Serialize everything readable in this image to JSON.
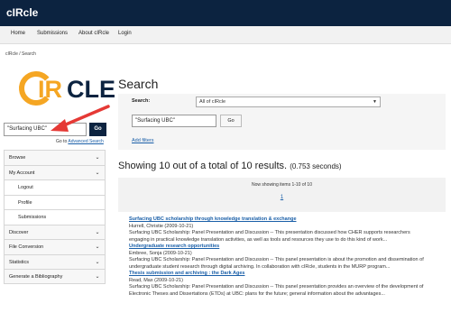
{
  "app": {
    "brand": "cIRcle"
  },
  "nav": {
    "items": [
      "Home",
      "Submissions",
      "About cIRcle",
      "Login"
    ]
  },
  "breadcrumb": "cIRcle  /  Search",
  "logo": {
    "text_prefix": "C",
    "text_main": "IRCLE"
  },
  "sidebar_search": {
    "value": "\"Surfacing UBC\"",
    "go_label": "Go",
    "goto_prefix": "Go to",
    "advanced_link": "Advanced Search"
  },
  "sidebar": {
    "items": [
      {
        "label": "Browse",
        "type": "parent"
      },
      {
        "label": "My Account",
        "type": "parent"
      },
      {
        "label": "Logout",
        "type": "sub"
      },
      {
        "label": "Profile",
        "type": "sub"
      },
      {
        "label": "Submissions",
        "type": "sub"
      },
      {
        "label": "Discover",
        "type": "parent"
      },
      {
        "label": "File Conversion",
        "type": "parent"
      },
      {
        "label": "Statistics",
        "type": "parent"
      },
      {
        "label": "Generate a Bibliography",
        "type": "parent"
      }
    ]
  },
  "main": {
    "title": "Search",
    "scope_label": "Search:",
    "scope_value": "All of cIRcle",
    "query_value": "\"Surfacing UBC\"",
    "query_go": "Go",
    "add_filters": "Add filters",
    "results_heading": "Showing 10 out of a total of 10 results.",
    "results_time": "(0.753 seconds)",
    "pager_info": "Now showing items 1-10 of 10",
    "pager_page": "1"
  },
  "results": [
    {
      "title": "Surfacing UBC scholarship through knowledge translation & exchange",
      "meta": "Hurrell, Christie (2009-10-21)",
      "abstract_1": "Surfacing UBC Scholarship: Panel Presentation and Discussion -- This presentation discussed how CHER supports researchers",
      "abstract_2": "engaging in practical knowledge translation activities, as well as tools and resources they use to do this kind of work..."
    },
    {
      "title": "Undergraduate research opportunities",
      "meta": "Embree, Sonja (2009-10-21)",
      "abstract_1": "Surfacing UBC Scholarship: Panel Presentation and Discussion -- This panel presentation is about the promotion and dissemination of",
      "abstract_2": "undergraduate student research through digital archiving. In collaboration with cIRcle, students in the MURP program..."
    },
    {
      "title": "Thesis submission and archiving : the Dark Ages",
      "meta": "Read, Max (2009-10-21)",
      "abstract_1": "Surfacing UBC Scholarship: Panel Presentation and Discussion -- This panel presentation provides an overview of the development of",
      "abstract_2": "Electronic Theses and Dissertations (ETDs) at UBC: plans for the future; general information about the advantages..."
    }
  ],
  "colors": {
    "header_bg": "#0c2340",
    "link": "#1a5fa8",
    "logo_orange": "#f5a623",
    "logo_navy": "#0c2340",
    "arrow_red": "#e53935"
  },
  "icons": {
    "chevron": "chevron-down-icon",
    "arrow": "red-arrow-annotation"
  }
}
